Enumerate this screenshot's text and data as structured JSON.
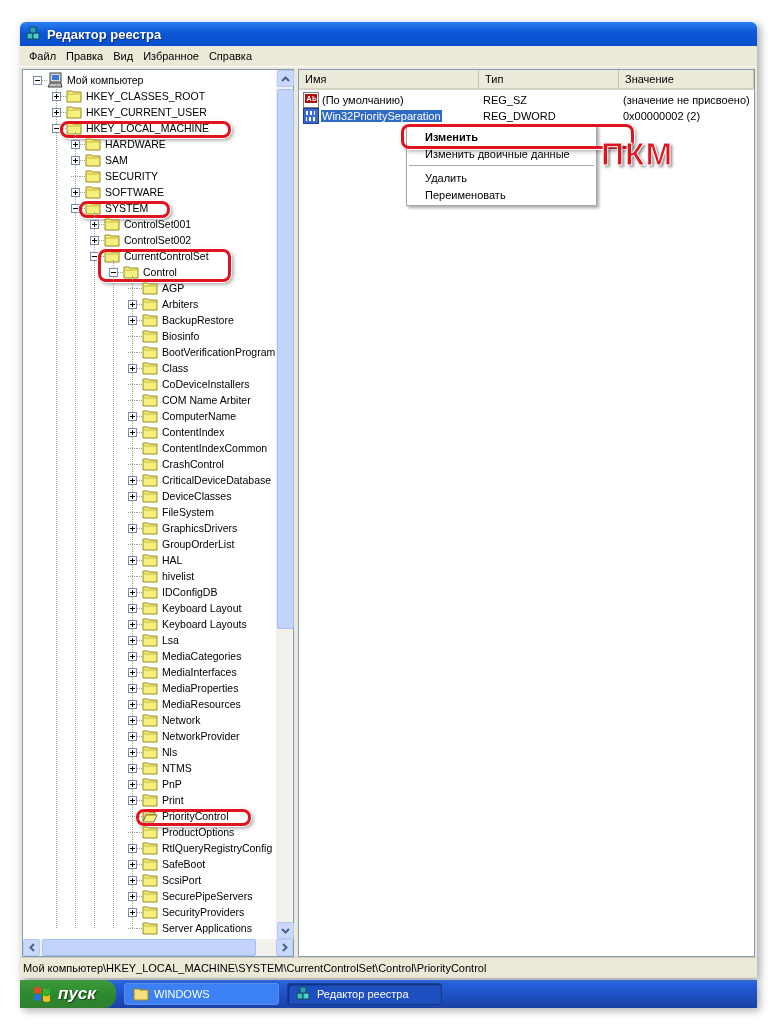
{
  "window": {
    "title": "Редактор реестра"
  },
  "menu": [
    "Файл",
    "Правка",
    "Вид",
    "Избранное",
    "Справка"
  ],
  "tree": [
    {
      "label": "Мой компьютер",
      "kind": "computer",
      "expanded": true,
      "selected": false,
      "children": [
        {
          "label": "HKEY_CLASSES_ROOT",
          "kind": "branch",
          "expanded": false,
          "selected": false
        },
        {
          "label": "HKEY_CURRENT_USER",
          "kind": "branch",
          "expanded": false,
          "selected": false
        },
        {
          "label": "HKEY_LOCAL_MACHINE",
          "kind": "branch",
          "expanded": true,
          "selected": false,
          "highlighted": true,
          "children": [
            {
              "label": "HARDWARE",
              "kind": "branch",
              "expanded": false,
              "selected": false
            },
            {
              "label": "SAM",
              "kind": "branch",
              "expanded": false,
              "selected": false
            },
            {
              "label": "SECURITY",
              "kind": "leaf",
              "selected": false
            },
            {
              "label": "SOFTWARE",
              "kind": "branch",
              "expanded": false,
              "selected": false
            },
            {
              "label": "SYSTEM",
              "kind": "branch",
              "expanded": true,
              "selected": false,
              "highlighted": true,
              "children": [
                {
                  "label": "ControlSet001",
                  "kind": "branch",
                  "expanded": false,
                  "selected": false
                },
                {
                  "label": "ControlSet002",
                  "kind": "branch",
                  "expanded": false,
                  "selected": false
                },
                {
                  "label": "CurrentControlSet",
                  "kind": "branch",
                  "expanded": true,
                  "selected": false,
                  "highlighted": true,
                  "children": [
                    {
                      "label": "Control",
                      "kind": "branch",
                      "expanded": true,
                      "selected": false,
                      "highlighted": true,
                      "children": [
                        {
                          "label": "AGP",
                          "kind": "leaf",
                          "selected": false
                        },
                        {
                          "label": "Arbiters",
                          "kind": "branch",
                          "expanded": false,
                          "selected": false
                        },
                        {
                          "label": "BackupRestore",
                          "kind": "branch",
                          "expanded": false,
                          "selected": false
                        },
                        {
                          "label": "Biosinfo",
                          "kind": "leaf",
                          "selected": false
                        },
                        {
                          "label": "BootVerificationProgram",
                          "kind": "leaf",
                          "selected": false
                        },
                        {
                          "label": "Class",
                          "kind": "branch",
                          "expanded": false,
                          "selected": false
                        },
                        {
                          "label": "CoDeviceInstallers",
                          "kind": "leaf",
                          "selected": false
                        },
                        {
                          "label": "COM Name Arbiter",
                          "kind": "leaf",
                          "selected": false
                        },
                        {
                          "label": "ComputerName",
                          "kind": "branch",
                          "expanded": false,
                          "selected": false
                        },
                        {
                          "label": "ContentIndex",
                          "kind": "branch",
                          "expanded": false,
                          "selected": false
                        },
                        {
                          "label": "ContentIndexCommon",
                          "kind": "leaf",
                          "selected": false
                        },
                        {
                          "label": "CrashControl",
                          "kind": "leaf",
                          "selected": false
                        },
                        {
                          "label": "CriticalDeviceDatabase",
                          "kind": "branch",
                          "expanded": false,
                          "selected": false
                        },
                        {
                          "label": "DeviceClasses",
                          "kind": "branch",
                          "expanded": false,
                          "selected": false
                        },
                        {
                          "label": "FileSystem",
                          "kind": "leaf",
                          "selected": false
                        },
                        {
                          "label": "GraphicsDrivers",
                          "kind": "branch",
                          "expanded": false,
                          "selected": false
                        },
                        {
                          "label": "GroupOrderList",
                          "kind": "leaf",
                          "selected": false
                        },
                        {
                          "label": "HAL",
                          "kind": "branch",
                          "expanded": false,
                          "selected": false
                        },
                        {
                          "label": "hivelist",
                          "kind": "leaf",
                          "selected": false
                        },
                        {
                          "label": "IDConfigDB",
                          "kind": "branch",
                          "expanded": false,
                          "selected": false
                        },
                        {
                          "label": "Keyboard Layout",
                          "kind": "branch",
                          "expanded": false,
                          "selected": false
                        },
                        {
                          "label": "Keyboard Layouts",
                          "kind": "branch",
                          "expanded": false,
                          "selected": false
                        },
                        {
                          "label": "Lsa",
                          "kind": "branch",
                          "expanded": false,
                          "selected": false
                        },
                        {
                          "label": "MediaCategories",
                          "kind": "branch",
                          "expanded": false,
                          "selected": false
                        },
                        {
                          "label": "MediaInterfaces",
                          "kind": "branch",
                          "expanded": false,
                          "selected": false
                        },
                        {
                          "label": "MediaProperties",
                          "kind": "branch",
                          "expanded": false,
                          "selected": false
                        },
                        {
                          "label": "MediaResources",
                          "kind": "branch",
                          "expanded": false,
                          "selected": false
                        },
                        {
                          "label": "Network",
                          "kind": "branch",
                          "expanded": false,
                          "selected": false
                        },
                        {
                          "label": "NetworkProvider",
                          "kind": "branch",
                          "expanded": false,
                          "selected": false
                        },
                        {
                          "label": "Nls",
                          "kind": "branch",
                          "expanded": false,
                          "selected": false
                        },
                        {
                          "label": "NTMS",
                          "kind": "branch",
                          "expanded": false,
                          "selected": false
                        },
                        {
                          "label": "PnP",
                          "kind": "branch",
                          "expanded": false,
                          "selected": false
                        },
                        {
                          "label": "Print",
                          "kind": "branch",
                          "expanded": false,
                          "selected": false
                        },
                        {
                          "label": "PriorityControl",
                          "kind": "leaf",
                          "selected": true,
                          "highlighted": true
                        },
                        {
                          "label": "ProductOptions",
                          "kind": "leaf",
                          "selected": false
                        },
                        {
                          "label": "RtlQueryRegistryConfig",
                          "kind": "branch",
                          "expanded": false,
                          "selected": false
                        },
                        {
                          "label": "SafeBoot",
                          "kind": "branch",
                          "expanded": false,
                          "selected": false
                        },
                        {
                          "label": "ScsiPort",
                          "kind": "branch",
                          "expanded": false,
                          "selected": false
                        },
                        {
                          "label": "SecurePipeServers",
                          "kind": "branch",
                          "expanded": false,
                          "selected": false
                        },
                        {
                          "label": "SecurityProviders",
                          "kind": "branch",
                          "expanded": false,
                          "selected": false
                        },
                        {
                          "label": "Server Applications",
                          "kind": "leaf",
                          "selected": false
                        }
                      ]
                    }
                  ]
                }
              ]
            }
          ]
        }
      ]
    }
  ],
  "values": {
    "columns": [
      "Имя",
      "Тип",
      "Значение"
    ],
    "rows": [
      {
        "name": "(По умолчанию)",
        "type": "REG_SZ",
        "data": "(значение не присвоено)",
        "kind": "string",
        "selected": false
      },
      {
        "name": "Win32PrioritySeparation",
        "type": "REG_DWORD",
        "data": "0x00000002 (2)",
        "kind": "binary",
        "selected": true
      }
    ]
  },
  "context_menu": [
    {
      "kind": "item",
      "label": "Изменить",
      "bold": true,
      "highlighted": true
    },
    {
      "kind": "item",
      "label": "Изменить двоичные данные",
      "bold": false
    },
    {
      "kind": "separator"
    },
    {
      "kind": "item",
      "label": "Удалить",
      "bold": false
    },
    {
      "kind": "item",
      "label": "Переименовать",
      "bold": false
    }
  ],
  "annotation": "ПКМ",
  "status_bar": "Мой компьютер\\HKEY_LOCAL_MACHINE\\SYSTEM\\CurrentControlSet\\Control\\PriorityControl",
  "taskbar": {
    "start": "пуск",
    "tasks": [
      {
        "label": "WINDOWS",
        "kind": "folder",
        "selected": false
      },
      {
        "label": "Редактор реестра",
        "kind": "regedit",
        "selected": true
      }
    ]
  }
}
